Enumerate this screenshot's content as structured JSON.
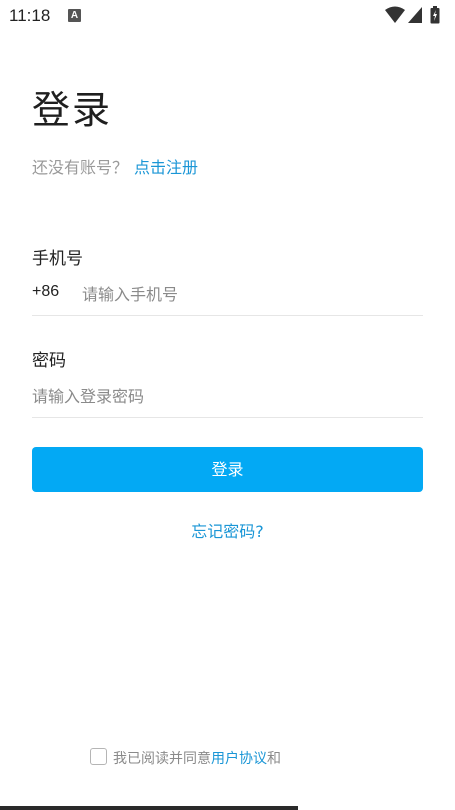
{
  "status_bar": {
    "time": "11:18",
    "notification_icon": "A",
    "icons": [
      "wifi-icon",
      "signal-icon",
      "battery-icon"
    ]
  },
  "page": {
    "title": "登录",
    "register_prompt": "还没有账号？",
    "register_link": "点击注册"
  },
  "phone_field": {
    "label": "手机号",
    "country_code": "+86",
    "placeholder": "请输入手机号",
    "value": ""
  },
  "password_field": {
    "label": "密码",
    "placeholder": "请输入登录密码",
    "value": ""
  },
  "login_button": {
    "label": "登录"
  },
  "forgot_password": {
    "label": "忘记密码?"
  },
  "agreement": {
    "checked": false,
    "prefix": "我已阅读并同意",
    "user_agreement_link": "用户协议",
    "connector": "和"
  },
  "colors": {
    "accent": "#03a9f4",
    "link": "#1a96d6",
    "placeholder": "#8a8a8a"
  }
}
